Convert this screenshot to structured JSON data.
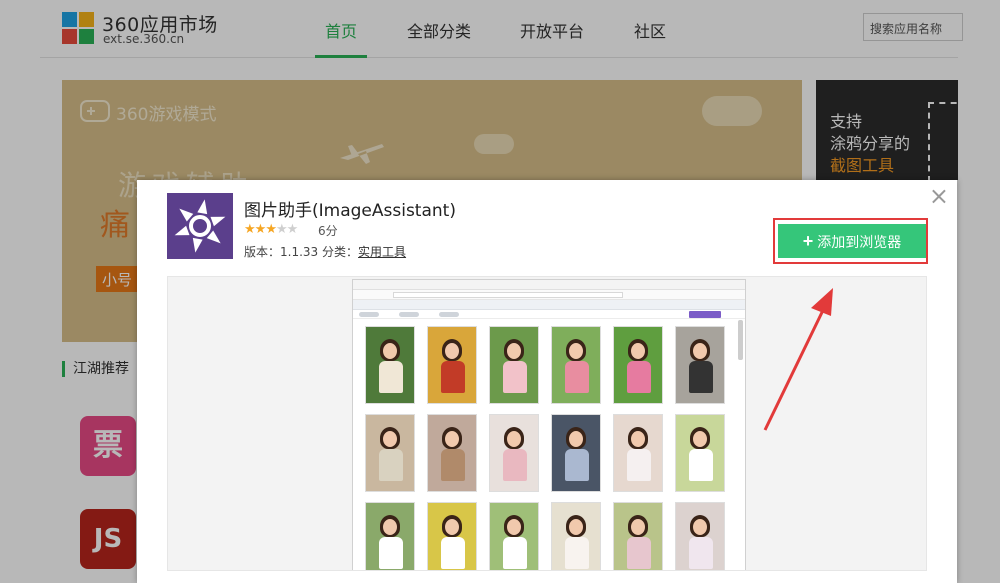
{
  "site": {
    "logo_title": "360应用市场",
    "logo_url": "ext.se.360.cn",
    "logo_colors": [
      "#1fa3e3",
      "#f5b31a",
      "#e84b3c",
      "#2ab257"
    ]
  },
  "nav": {
    "items": [
      {
        "label": "首页",
        "active": true
      },
      {
        "label": "全部分类",
        "active": false
      },
      {
        "label": "开放平台",
        "active": false
      },
      {
        "label": "社区",
        "active": false
      }
    ],
    "search_placeholder": "搜索应用名称"
  },
  "banner": {
    "mode_label": "360游戏模式",
    "headline": "游戏辅助",
    "accent_char": "痛",
    "tag": "小号"
  },
  "side_banner": {
    "line1": "支持",
    "line2": "涂鸦分享的",
    "line3": "截图工具"
  },
  "section": {
    "title": "江湖推荐",
    "tiles": [
      {
        "glyph": "票",
        "color": "#e84a86"
      },
      {
        "glyph": "JS",
        "color": "#b8251d"
      }
    ]
  },
  "modal": {
    "app_name": "图片助手(ImageAssistant)",
    "rating_value": 3,
    "rating_max": 5,
    "score_text": "6分",
    "version_prefix": "版本：",
    "version": "1.1.33",
    "category_prefix": "分类：",
    "category": "实用工具",
    "add_button_label": "添加到浏览器",
    "close_label": "×",
    "accent_color": "#35c67a",
    "highlight_color": "#e23a3a"
  }
}
